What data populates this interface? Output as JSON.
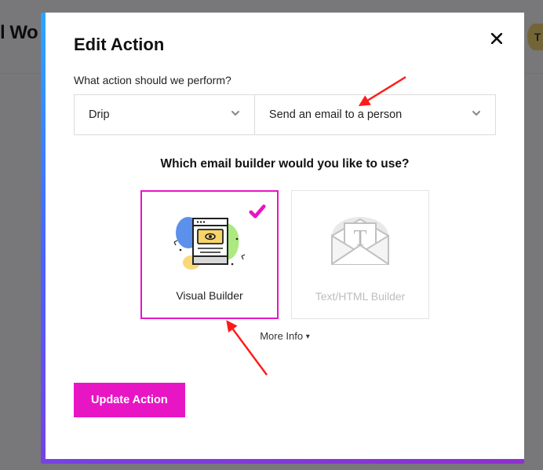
{
  "bg": {
    "partial_text": "l Wo",
    "avatar_initial": "T"
  },
  "modal": {
    "title": "Edit Action",
    "q1": "What action should we perform?",
    "select1": "Drip",
    "select2": "Send an email to a person",
    "q2": "Which email builder would you like to use?",
    "card1": "Visual Builder",
    "card2": "Text/HTML Builder",
    "more_info": "More Info",
    "update_btn": "Update Action"
  }
}
